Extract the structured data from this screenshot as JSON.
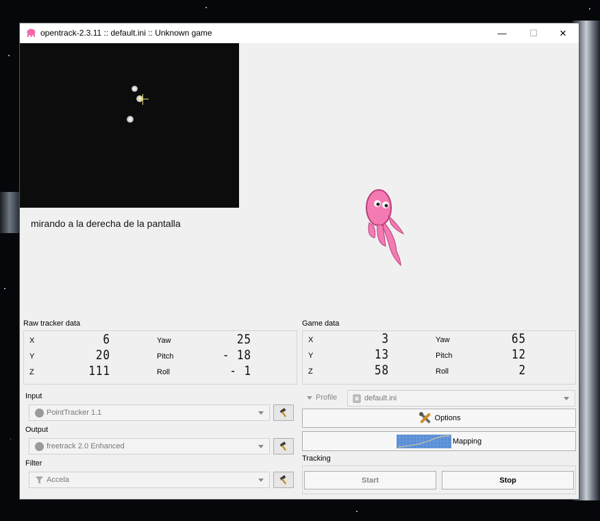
{
  "window": {
    "title": "opentrack-2.3.11 :: default.ini :: Unknown game",
    "minimize_glyph": "—",
    "maximize_glyph": "☐",
    "close_glyph": "✕"
  },
  "caption": "mirando a la derecha de la pantalla",
  "raw_tracker": {
    "label": "Raw tracker data",
    "x_label": "X",
    "x": "6",
    "y_label": "Y",
    "y": "20",
    "z_label": "Z",
    "z": "111",
    "yaw_label": "Yaw",
    "yaw": "25",
    "pitch_label": "Pitch",
    "pitch": "- 18",
    "roll_label": "Roll",
    "roll": "- 1"
  },
  "game_data": {
    "label": "Game data",
    "x_label": "X",
    "x": "3",
    "y_label": "Y",
    "y": "13",
    "z_label": "Z",
    "z": "58",
    "yaw_label": "Yaw",
    "yaw": "65",
    "pitch_label": "Pitch",
    "pitch": "12",
    "roll_label": "Roll",
    "roll": "2"
  },
  "input": {
    "label": "Input",
    "value": "PointTracker 1.1",
    "icon": "pointtracker-icon"
  },
  "output": {
    "label": "Output",
    "value": "freetrack 2.0 Enhanced",
    "icon": "freetrack-icon"
  },
  "filter": {
    "label": "Filter",
    "value": "Accela",
    "icon": "funnel-icon"
  },
  "profile": {
    "label": "Profile",
    "value": "default.ini"
  },
  "buttons": {
    "options": "Options",
    "mapping": "Mapping",
    "tracking_label": "Tracking",
    "start": "Start",
    "stop": "Stop"
  },
  "colors": {
    "accent_mascot": "#f06aa8",
    "window_bg": "#f0f0f0",
    "video_bg": "#0d0c0c"
  }
}
